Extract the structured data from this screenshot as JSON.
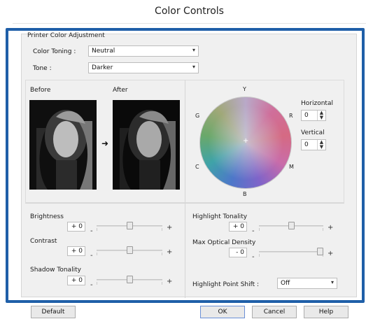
{
  "window": {
    "title": "Color Controls"
  },
  "printer_color_adjustment": {
    "legend": "Printer Color Adjustment",
    "color_toning": {
      "label": "Color Toning :",
      "value": "Neutral"
    },
    "tone": {
      "label": "Tone :",
      "value": "Darker"
    }
  },
  "preview": {
    "before_label": "Before",
    "after_label": "After"
  },
  "color_wheel": {
    "letters": {
      "Y": "Y",
      "R": "R",
      "M": "M",
      "B": "B",
      "C": "C",
      "G": "G"
    },
    "horizontal": {
      "label": "Horizontal",
      "value": "0"
    },
    "vertical": {
      "label": "Vertical",
      "value": "0"
    },
    "center_mark": "+"
  },
  "sliders_left": [
    {
      "label": "Brightness",
      "value": "+ 0",
      "minus": "-",
      "plus": "+",
      "position": 0.5
    },
    {
      "label": "Contrast",
      "value": "+ 0",
      "minus": "-",
      "plus": "+",
      "position": 0.5
    },
    {
      "label": "Shadow Tonality",
      "value": "+ 0",
      "minus": "-",
      "plus": "+",
      "position": 0.5
    }
  ],
  "sliders_right": [
    {
      "label": "Highlight Tonality",
      "value": "+ 0",
      "minus": "-",
      "plus": "+",
      "position": 0.5
    },
    {
      "label": "Max Optical Density",
      "value": "- 0",
      "minus": "-",
      "plus": "+",
      "position": 1.0
    }
  ],
  "highlight_point_shift": {
    "label": "Highlight Point Shift :",
    "value": "Off"
  },
  "buttons": {
    "default": "Default",
    "ok": "OK",
    "cancel": "Cancel",
    "help": "Help"
  },
  "colors": {
    "highlight_frame": "#1f5fa8",
    "panel_bg": "#f0f0f0"
  }
}
